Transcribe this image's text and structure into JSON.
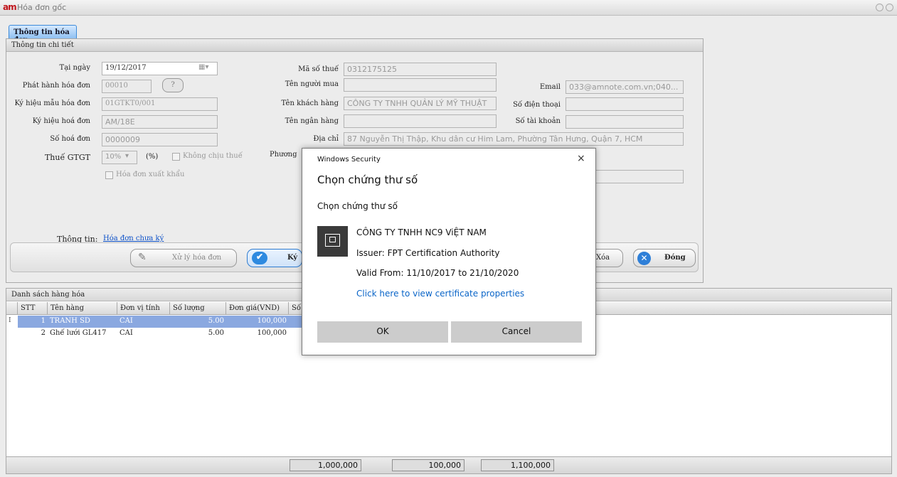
{
  "window": {
    "logo": "am",
    "title": "Hóa đơn gốc"
  },
  "tab": {
    "label": "Thông tin hóa đơn"
  },
  "detail": {
    "header": "Thông tin chi tiết",
    "tai_ngay_label": "Tại ngày",
    "tai_ngay": "19/12/2017",
    "phat_hanh_label": "Phát hành hóa đơn",
    "phat_hanh": "00010",
    "phat_hanh_btn": "?",
    "ky_hieu_mau_label": "Ký hiệu mẫu hóa đơn",
    "ky_hieu_mau": "01GTKT0/001",
    "ky_hieu_label": "Ký hiệu hoá đơn",
    "ky_hieu": "AM/18E",
    "so_hoa_don_label": "Số hoá đơn",
    "so_hoa_don": "0000009",
    "thue_label": "Thuế GTGT",
    "thue": "10%",
    "thue_unit": "(%)",
    "khong_chiu_thue": "Không chịu thuế",
    "xuat_khau": "Hóa đơn xuất khẩu",
    "ma_so_thue_label": "Mã số thuế",
    "ma_so_thue": "0312175125",
    "nguoi_mua_label": "Tên người mua",
    "nguoi_mua": "",
    "khach_hang_label": "Tên khách hàng",
    "khach_hang": "CÔNG TY TNHH QUẢN LÝ MỸ THUẬT",
    "ngan_hang_label": "Tên ngân hàng",
    "ngan_hang": "",
    "dia_chi_label": "Địa chỉ",
    "dia_chi": "87 Nguyễn Thị Thập, Khu dân cư Him Lam, Phường Tân Hưng, Quận 7, HCM",
    "phuong_label": "Phương",
    "email_label": "Email",
    "email": "033@amnote.com.vn;040...",
    "dien_thoai_label": "Số điện thoại",
    "dien_thoai": "",
    "tai_khoan_label": "Số tài khoản",
    "tai_khoan": "",
    "thong_tin_label": "Thông tin:",
    "thong_tin_link": "Hóa đơn chưa ký"
  },
  "actions": {
    "xu_ly": "Xử lý hóa đơn",
    "ky": "Ký",
    "xoa": "Xóa",
    "dong": "Đóng"
  },
  "goods": {
    "header": "Danh sách hàng hóa",
    "columns": [
      "STT",
      "Tên hàng",
      "Đơn vị tính",
      "Số lượng",
      "Đơn giá(VND)",
      "Số"
    ],
    "rows": [
      {
        "stt": "1",
        "ten": "TRANH SD",
        "dvt": "CAI",
        "sl": "5.00",
        "dg": "100,000"
      },
      {
        "stt": "2",
        "ten": "Ghế lưới GL417",
        "dvt": "CAI",
        "sl": "5.00",
        "dg": "100,000"
      }
    ],
    "row_marker": "I",
    "totals": [
      "1,000,000",
      "100,000",
      "1,100,000"
    ]
  },
  "dialog": {
    "title": "Windows Security",
    "heading": "Chọn chứng thư số",
    "subheading": "Chọn chứng thư số",
    "company": "CÔNG TY TNHH NC9 ViỆT NAM",
    "issuer": "Issuer: FPT Certification Authority",
    "valid": "Valid From: 11/10/2017 to 21/10/2020",
    "link": "Click here to view certificate properties",
    "ok": "OK",
    "cancel": "Cancel",
    "close": "×"
  },
  "colors": {
    "selected_row": "#8aa8e0",
    "link": "#0a65c8",
    "tab": "#8fc0f2"
  }
}
